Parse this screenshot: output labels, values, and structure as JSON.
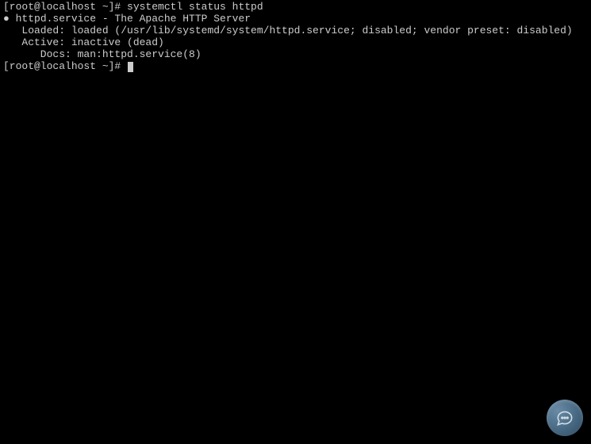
{
  "terminal": {
    "prompt1": "[root@localhost ~]# ",
    "command1": "systemctl status httpd",
    "bullet": "● ",
    "service_line": "httpd.service - The Apache HTTP Server",
    "loaded_label": "Loaded: ",
    "loaded_value": "loaded (/usr/lib/systemd/system/httpd.service; disabled; vendor preset: disabled)",
    "active_label": "Active: ",
    "active_value": "inactive (dead)",
    "docs_label": "Docs: ",
    "docs_value": "man:httpd.service(8)",
    "prompt2": "[root@localhost ~]# "
  }
}
